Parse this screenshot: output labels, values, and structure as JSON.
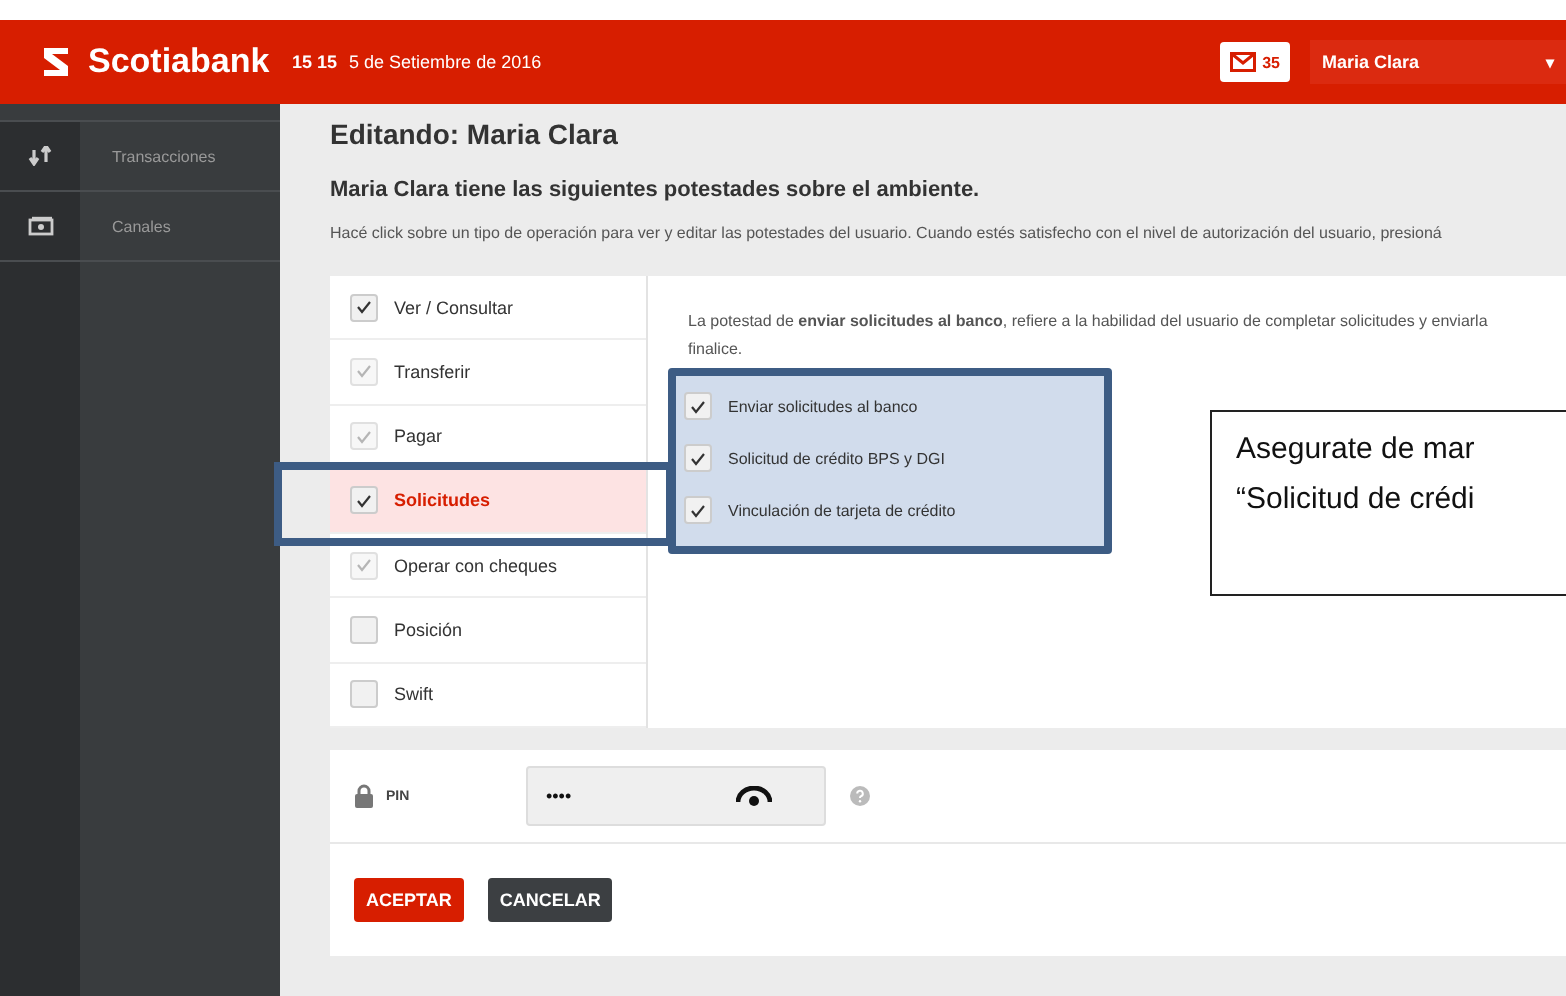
{
  "header": {
    "brand": "Scotiabank",
    "time": "15 15",
    "date": "5 de Setiembre de 2016",
    "messages": "35",
    "user": "Maria Clara",
    "user_caret": "▾"
  },
  "sidebar": {
    "items": [
      {
        "label": "Transacciones"
      },
      {
        "label": "Canales"
      }
    ]
  },
  "page": {
    "title": "Editando: Maria Clara",
    "subtitle": "Maria Clara tiene las siguientes potestades sobre el ambiente.",
    "instructions": "Hacé click sobre un tipo de operación para ver y editar las potestades del usuario. Cuando estés satisfecho con el nivel de autorización del usuario, presioná"
  },
  "operations": [
    {
      "label": "Ver / Consultar",
      "checked": true,
      "disabled": false,
      "selected": false
    },
    {
      "label": "Transferir",
      "checked": true,
      "disabled": true,
      "selected": false
    },
    {
      "label": "Pagar",
      "checked": true,
      "disabled": true,
      "selected": false
    },
    {
      "label": "Solicitudes",
      "checked": true,
      "disabled": false,
      "selected": true
    },
    {
      "label": "Operar con cheques",
      "checked": true,
      "disabled": true,
      "selected": false
    },
    {
      "label": "Posición",
      "checked": false,
      "disabled": false,
      "selected": false
    },
    {
      "label": "Swift",
      "checked": false,
      "disabled": false,
      "selected": false
    }
  ],
  "detail": {
    "description_lines": [
      "La potestad de **enviar solicitudes al banco**, refiere a la habilidad del usuario de completar solicitudes y enviarla",
      "finalice."
    ],
    "options": [
      {
        "label": "Enviar solicitudes al banco",
        "checked": true
      },
      {
        "label": "Solicitud de crédito BPS y DGI",
        "checked": true
      },
      {
        "label": "Vinculación de tarjeta de crédito",
        "checked": true
      }
    ]
  },
  "annotation": {
    "callout_lines": [
      "Asegurate de mar",
      "“Solicitud de crédi"
    ]
  },
  "pin": {
    "label": "PIN",
    "value": "••••"
  },
  "buttons": [
    {
      "label": "ACEPTAR",
      "kind": "primary"
    },
    {
      "label": "CANCELAR",
      "kind": "secondary"
    }
  ]
}
